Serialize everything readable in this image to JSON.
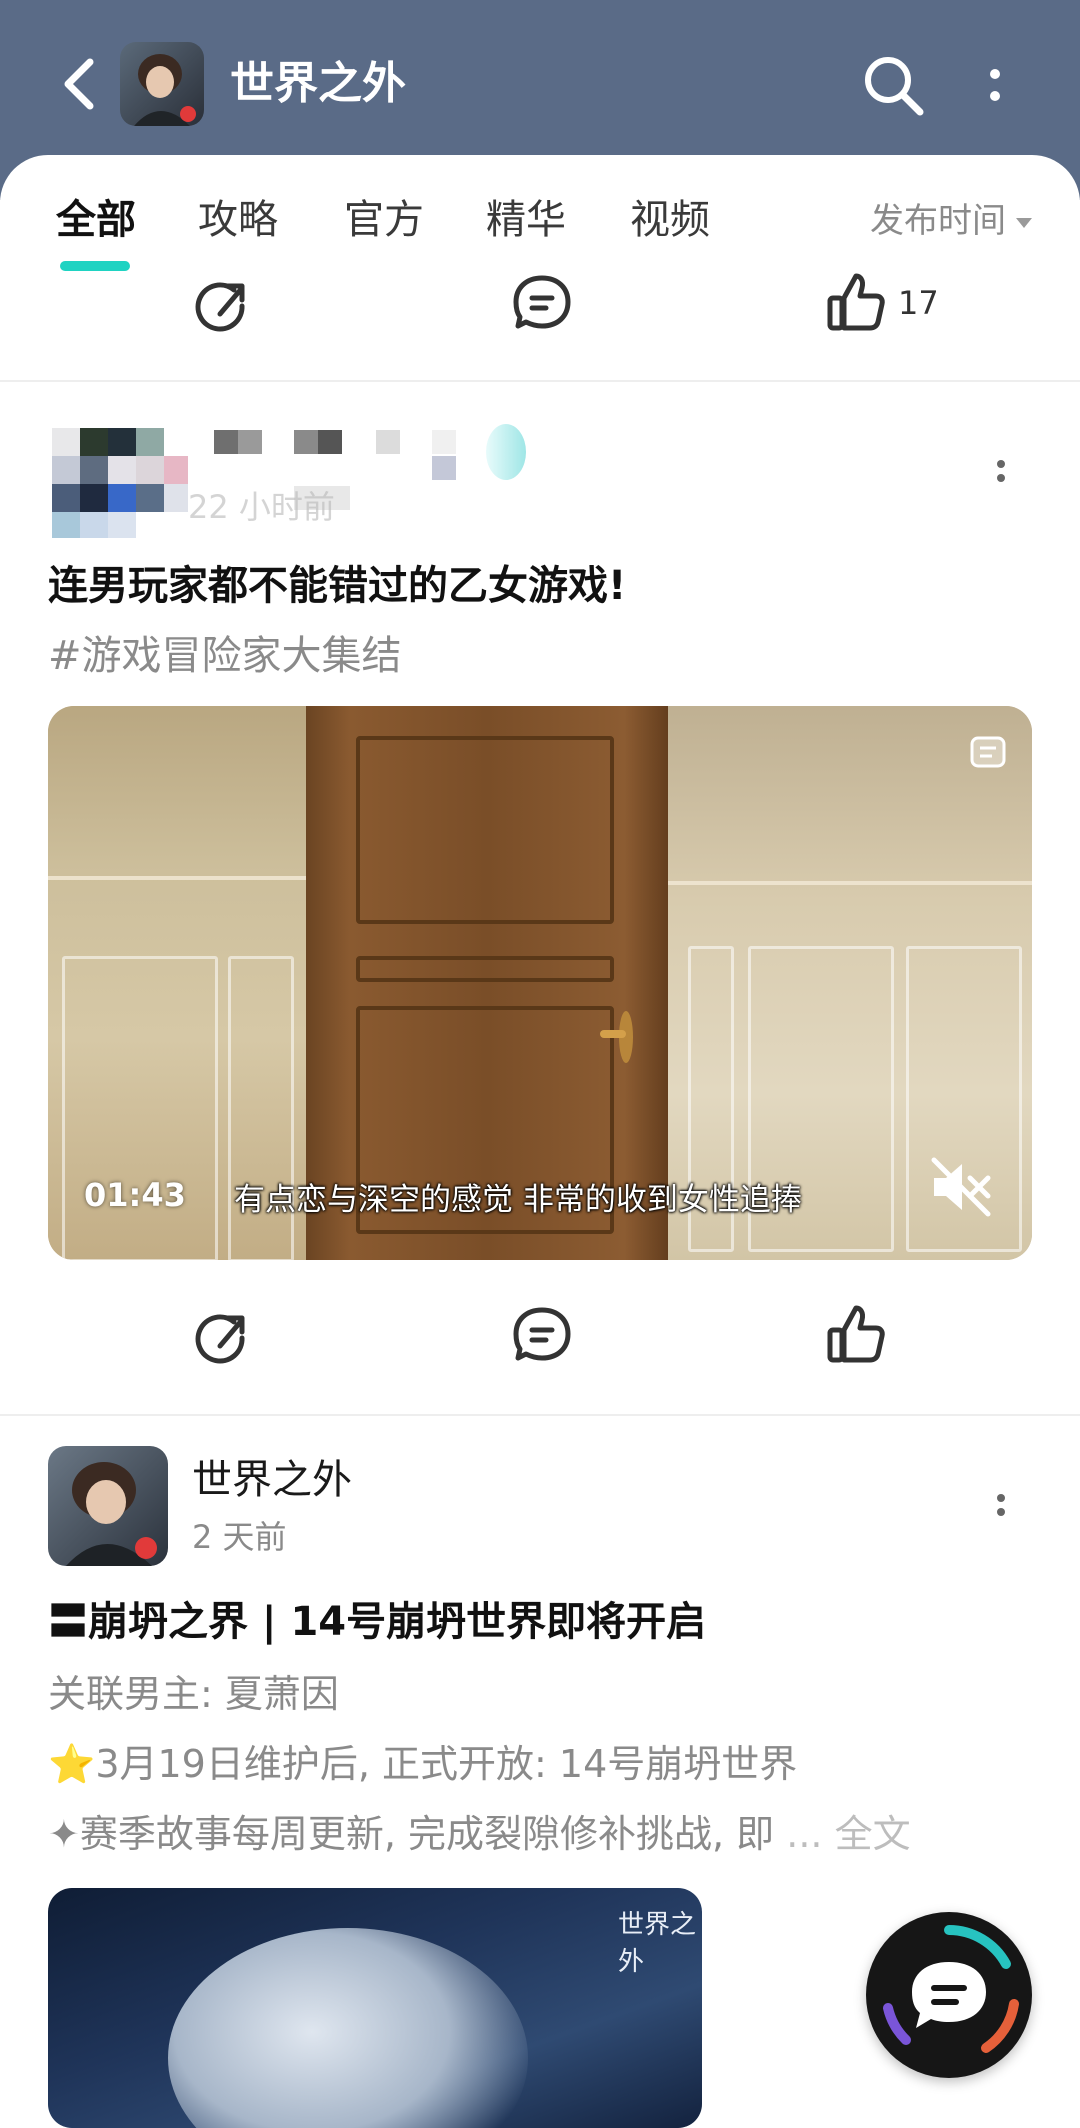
{
  "header": {
    "title": "世界之外",
    "back_icon": "chevron-left-icon",
    "search_icon": "search-icon",
    "more_icon": "vertical-dots-icon",
    "bg_color": "#5a6b87"
  },
  "tabs": {
    "items": [
      {
        "label": "全部",
        "active": true
      },
      {
        "label": "攻略",
        "active": false
      },
      {
        "label": "官方",
        "active": false
      },
      {
        "label": "精华",
        "active": false
      },
      {
        "label": "视频",
        "active": false
      }
    ],
    "sort_label": "发布时间",
    "accent_color": "#1fd3c2"
  },
  "prev_post": {
    "like_count": "17"
  },
  "post1": {
    "time": "22 小时前",
    "title": "连男玩家都不能错过的乙女游戏!",
    "topic": "#游戏冒险家大集结",
    "video": {
      "duration": "01:43",
      "subtitle": "有点恋与深空的感觉 非常的收到女性追捧",
      "muted": true
    }
  },
  "post2": {
    "author": "世界之外",
    "time": "2 天前",
    "title": "〓崩坍之界 | 14号崩坍世界即将开启",
    "lines": [
      "关联男主: 夏萧因",
      "⭐3月19日维护后, 正式开放: 14号崩坍世界",
      "✦赛季故事每周更新, 完成裂隙修补挑战, 即"
    ],
    "ellipsis": "...",
    "fulltext_label": "全文",
    "image_logo": "世界之外"
  }
}
